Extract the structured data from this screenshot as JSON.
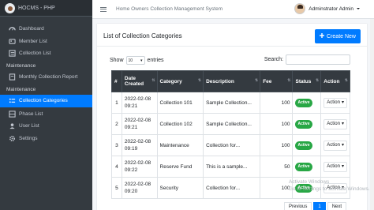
{
  "brand": {
    "title": "HOCMS - PHP"
  },
  "topbar": {
    "title": "Home Owners Collection Management System",
    "user": "Adminstrator Admin"
  },
  "sidebar": {
    "items": [
      {
        "label": "Dashboard",
        "icon": "dashboard-icon"
      },
      {
        "label": "Member List",
        "icon": "members-icon"
      },
      {
        "label": "Collection List",
        "icon": "list-icon"
      }
    ],
    "maintenance_header_1": "Maintenance",
    "items2": [
      {
        "label": "Monthly Collection Report",
        "icon": "report-icon"
      }
    ],
    "maintenance_header_2": "Maintenance",
    "items3": [
      {
        "label": "Collection Categories",
        "icon": "list-icon",
        "active": true
      },
      {
        "label": "Phase List",
        "icon": "table-icon"
      },
      {
        "label": "User List",
        "icon": "users-icon"
      },
      {
        "label": "Settings",
        "icon": "gear-icon"
      }
    ]
  },
  "card": {
    "title": "List of Collection Categories",
    "create_label": "Create New"
  },
  "controls": {
    "show_label": "Show",
    "entries_value": "10",
    "entries_label": "entries",
    "search_label": "Search:"
  },
  "table": {
    "headers": [
      "#",
      "Date Created",
      "Category",
      "Description",
      "Fee",
      "Status",
      "Action"
    ],
    "rows": [
      {
        "num": "1",
        "date": "2022-02-08",
        "time": "09:21",
        "category": "Collection 101",
        "description": "Sample Collection...",
        "fee": "100",
        "status": "Active",
        "action": "Action"
      },
      {
        "num": "2",
        "date": "2022-02-08",
        "time": "09:21",
        "category": "Collection 102",
        "description": "Sample Collection...",
        "fee": "100",
        "status": "Active",
        "action": "Action"
      },
      {
        "num": "3",
        "date": "2022-02-08",
        "time": "09:19",
        "category": "Maintenance",
        "description": "Collection for...",
        "fee": "100",
        "status": "Active",
        "action": "Action"
      },
      {
        "num": "4",
        "date": "2022-02-08",
        "time": "09:22",
        "category": "Reserve Fund",
        "description": "This is a sample...",
        "fee": "50",
        "status": "Active",
        "action": "Action"
      },
      {
        "num": "5",
        "date": "2022-02-08",
        "time": "09:20",
        "category": "Security",
        "description": "Collection for...",
        "fee": "100",
        "status": "Active",
        "action": "Action"
      }
    ]
  },
  "watermark": {
    "line1": "Activate Windows",
    "line2": "Go to Settings to activate Windows."
  },
  "pager": {
    "prev": "Previous",
    "current": "1",
    "next": "Next"
  },
  "colors": {
    "primary": "#007bff",
    "sidebar": "#343a40",
    "success": "#28a745"
  }
}
